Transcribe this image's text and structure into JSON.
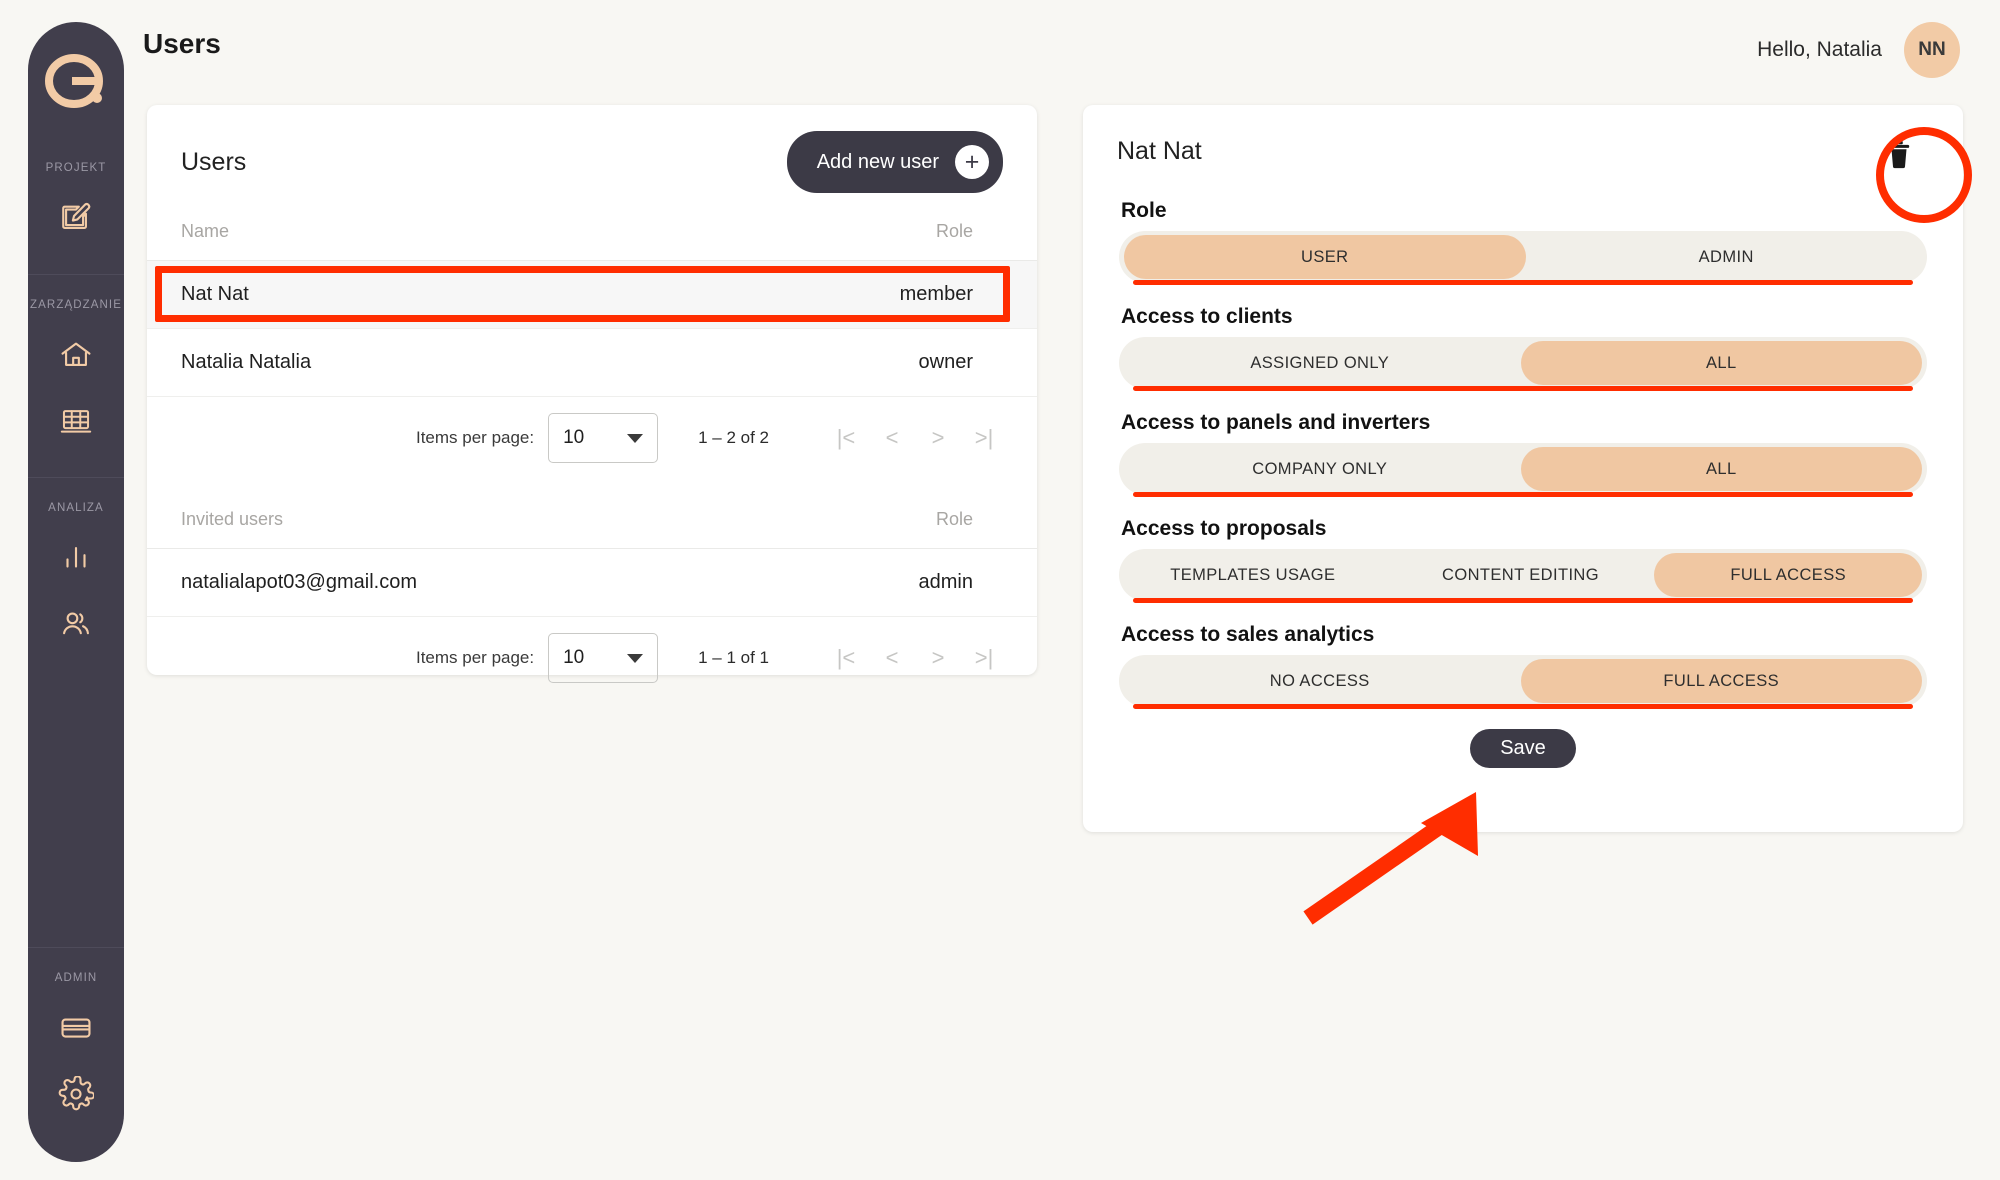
{
  "app": {
    "page_title": "Users",
    "greeting": "Hello, Natalia",
    "avatar_initials": "NN",
    "logo_letter": "e"
  },
  "colors": {
    "sidebar_bg": "#413E4C",
    "page_bg": "#F8F7F3",
    "accent_peach": "#F0C7A2",
    "annotation_red": "#FF2D00",
    "dark_button": "#3C3A46",
    "track_bg": "#F1EFE9"
  },
  "sidebar": {
    "sections": [
      {
        "label": "PROJEKT",
        "items": [
          {
            "icon": "edit-document-icon",
            "name": "sidebar-item-projekt-edit"
          }
        ]
      },
      {
        "label": "ZARZADZANIE",
        "label_display": "ZARZĄDZANIE",
        "items": [
          {
            "icon": "home-icon",
            "name": "sidebar-item-home"
          },
          {
            "icon": "solar-panel-icon",
            "name": "sidebar-item-panels"
          }
        ]
      },
      {
        "label": "ANALIZA",
        "items": [
          {
            "icon": "bar-chart-icon",
            "name": "sidebar-item-analytics"
          },
          {
            "icon": "users-icon",
            "name": "sidebar-item-users"
          }
        ]
      },
      {
        "label": "ADMIN",
        "items": [
          {
            "icon": "credit-card-icon",
            "name": "sidebar-item-billing"
          },
          {
            "icon": "gear-icon",
            "name": "sidebar-item-settings"
          }
        ]
      }
    ]
  },
  "users_card": {
    "title": "Users",
    "add_button_label": "Add new user",
    "add_button_icon": "plus-icon",
    "members_table": {
      "headers": {
        "name": "Name",
        "role": "Role"
      },
      "rows": [
        {
          "name": "Nat Nat",
          "role": "member",
          "selected": true
        },
        {
          "name": "Natalia Natalia",
          "role": "owner",
          "selected": false
        }
      ],
      "paginator": {
        "items_per_page_label": "Items per page:",
        "items_per_page_value": "10",
        "range_label": "1 – 2 of 2",
        "first_icon": "first-page-icon",
        "prev_icon": "previous-page-icon",
        "next_icon": "next-page-icon",
        "last_icon": "last-page-icon"
      }
    },
    "invited_table": {
      "headers": {
        "name": "Invited users",
        "role": "Role"
      },
      "rows": [
        {
          "name": "natalialapot03@gmail.com",
          "role": "admin",
          "selected": false
        }
      ],
      "paginator": {
        "items_per_page_label": "Items per page:",
        "items_per_page_value": "10",
        "range_label": "1 – 1 of 1",
        "first_icon": "first-page-icon",
        "prev_icon": "previous-page-icon",
        "next_icon": "next-page-icon",
        "last_icon": "last-page-icon"
      }
    }
  },
  "detail_card": {
    "user_name": "Nat Nat",
    "delete_icon": "trash-icon",
    "save_label": "Save",
    "fields": [
      {
        "label": "Role",
        "name": "role",
        "options": [
          "USER",
          "ADMIN"
        ],
        "selected": "USER",
        "selected_index": 0,
        "underlined": true
      },
      {
        "label": "Access to clients",
        "name": "access-to-clients",
        "options": [
          "ASSIGNED ONLY",
          "ALL"
        ],
        "selected": "ALL",
        "selected_index": 1,
        "underlined": true
      },
      {
        "label": "Access to panels and inverters",
        "name": "access-to-panels-and-inverters",
        "options": [
          "COMPANY ONLY",
          "ALL"
        ],
        "selected": "ALL",
        "selected_index": 1,
        "underlined": true
      },
      {
        "label": "Access to proposals",
        "name": "access-to-proposals",
        "options": [
          "TEMPLATES USAGE",
          "CONTENT EDITING",
          "FULL ACCESS"
        ],
        "selected": "FULL ACCESS",
        "selected_index": 2,
        "underlined": true
      },
      {
        "label": "Access to sales analytics",
        "name": "access-to-sales-analytics",
        "options": [
          "NO ACCESS",
          "FULL ACCESS"
        ],
        "selected": "FULL ACCESS",
        "selected_index": 1,
        "underlined": true
      }
    ]
  },
  "annotations": {
    "selected_row_box": true,
    "delete_button_circle": true,
    "arrow_to_save_button": true
  }
}
